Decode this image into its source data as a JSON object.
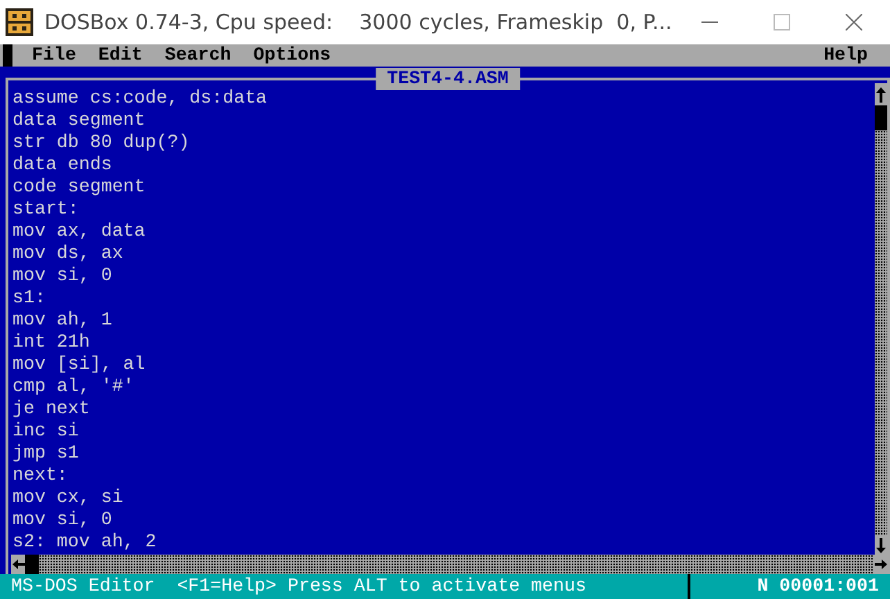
{
  "window": {
    "title": "DOSBox 0.74-3, Cpu speed:    3000 cycles, Frameskip  0, P..."
  },
  "menu": [
    {
      "label": "File"
    },
    {
      "label": "Edit"
    },
    {
      "label": "Search"
    },
    {
      "label": "Options"
    }
  ],
  "help_menu": "Help",
  "editor": {
    "file_name": "TEST4-4.ASM",
    "lines": [
      "assume cs:code, ds:data",
      "data segment",
      "str db 80 dup(?)",
      "data ends",
      "code segment",
      "start:",
      "mov ax, data",
      "mov ds, ax",
      "mov si, 0",
      "s1:",
      "mov ah, 1",
      "int 21h",
      "mov [si], al",
      "cmp al, '#'",
      "je next",
      "inc si",
      "jmp s1",
      "next:",
      "mov cx, si",
      "mov si, 0",
      "s2: mov ah, 2"
    ]
  },
  "status_bar": {
    "message": "MS-DOS Editor  <F1=Help> Press ALT to activate menus",
    "position": "N 00001:001"
  }
}
